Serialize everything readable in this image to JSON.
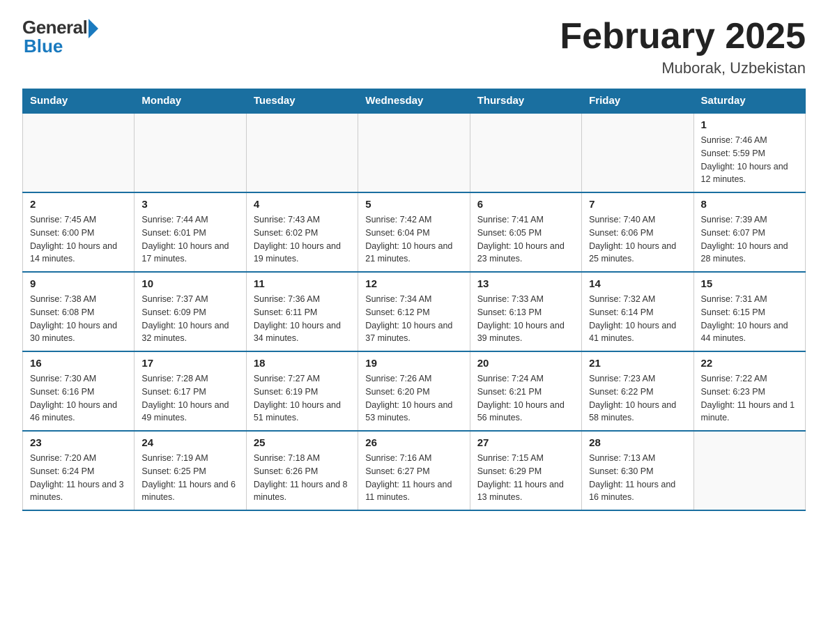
{
  "header": {
    "logo": {
      "general": "General",
      "blue": "Blue"
    },
    "title": "February 2025",
    "location": "Muborak, Uzbekistan"
  },
  "days_of_week": [
    "Sunday",
    "Monday",
    "Tuesday",
    "Wednesday",
    "Thursday",
    "Friday",
    "Saturday"
  ],
  "weeks": [
    [
      {
        "day": "",
        "info": ""
      },
      {
        "day": "",
        "info": ""
      },
      {
        "day": "",
        "info": ""
      },
      {
        "day": "",
        "info": ""
      },
      {
        "day": "",
        "info": ""
      },
      {
        "day": "",
        "info": ""
      },
      {
        "day": "1",
        "info": "Sunrise: 7:46 AM\nSunset: 5:59 PM\nDaylight: 10 hours and 12 minutes."
      }
    ],
    [
      {
        "day": "2",
        "info": "Sunrise: 7:45 AM\nSunset: 6:00 PM\nDaylight: 10 hours and 14 minutes."
      },
      {
        "day": "3",
        "info": "Sunrise: 7:44 AM\nSunset: 6:01 PM\nDaylight: 10 hours and 17 minutes."
      },
      {
        "day": "4",
        "info": "Sunrise: 7:43 AM\nSunset: 6:02 PM\nDaylight: 10 hours and 19 minutes."
      },
      {
        "day": "5",
        "info": "Sunrise: 7:42 AM\nSunset: 6:04 PM\nDaylight: 10 hours and 21 minutes."
      },
      {
        "day": "6",
        "info": "Sunrise: 7:41 AM\nSunset: 6:05 PM\nDaylight: 10 hours and 23 minutes."
      },
      {
        "day": "7",
        "info": "Sunrise: 7:40 AM\nSunset: 6:06 PM\nDaylight: 10 hours and 25 minutes."
      },
      {
        "day": "8",
        "info": "Sunrise: 7:39 AM\nSunset: 6:07 PM\nDaylight: 10 hours and 28 minutes."
      }
    ],
    [
      {
        "day": "9",
        "info": "Sunrise: 7:38 AM\nSunset: 6:08 PM\nDaylight: 10 hours and 30 minutes."
      },
      {
        "day": "10",
        "info": "Sunrise: 7:37 AM\nSunset: 6:09 PM\nDaylight: 10 hours and 32 minutes."
      },
      {
        "day": "11",
        "info": "Sunrise: 7:36 AM\nSunset: 6:11 PM\nDaylight: 10 hours and 34 minutes."
      },
      {
        "day": "12",
        "info": "Sunrise: 7:34 AM\nSunset: 6:12 PM\nDaylight: 10 hours and 37 minutes."
      },
      {
        "day": "13",
        "info": "Sunrise: 7:33 AM\nSunset: 6:13 PM\nDaylight: 10 hours and 39 minutes."
      },
      {
        "day": "14",
        "info": "Sunrise: 7:32 AM\nSunset: 6:14 PM\nDaylight: 10 hours and 41 minutes."
      },
      {
        "day": "15",
        "info": "Sunrise: 7:31 AM\nSunset: 6:15 PM\nDaylight: 10 hours and 44 minutes."
      }
    ],
    [
      {
        "day": "16",
        "info": "Sunrise: 7:30 AM\nSunset: 6:16 PM\nDaylight: 10 hours and 46 minutes."
      },
      {
        "day": "17",
        "info": "Sunrise: 7:28 AM\nSunset: 6:17 PM\nDaylight: 10 hours and 49 minutes."
      },
      {
        "day": "18",
        "info": "Sunrise: 7:27 AM\nSunset: 6:19 PM\nDaylight: 10 hours and 51 minutes."
      },
      {
        "day": "19",
        "info": "Sunrise: 7:26 AM\nSunset: 6:20 PM\nDaylight: 10 hours and 53 minutes."
      },
      {
        "day": "20",
        "info": "Sunrise: 7:24 AM\nSunset: 6:21 PM\nDaylight: 10 hours and 56 minutes."
      },
      {
        "day": "21",
        "info": "Sunrise: 7:23 AM\nSunset: 6:22 PM\nDaylight: 10 hours and 58 minutes."
      },
      {
        "day": "22",
        "info": "Sunrise: 7:22 AM\nSunset: 6:23 PM\nDaylight: 11 hours and 1 minute."
      }
    ],
    [
      {
        "day": "23",
        "info": "Sunrise: 7:20 AM\nSunset: 6:24 PM\nDaylight: 11 hours and 3 minutes."
      },
      {
        "day": "24",
        "info": "Sunrise: 7:19 AM\nSunset: 6:25 PM\nDaylight: 11 hours and 6 minutes."
      },
      {
        "day": "25",
        "info": "Sunrise: 7:18 AM\nSunset: 6:26 PM\nDaylight: 11 hours and 8 minutes."
      },
      {
        "day": "26",
        "info": "Sunrise: 7:16 AM\nSunset: 6:27 PM\nDaylight: 11 hours and 11 minutes."
      },
      {
        "day": "27",
        "info": "Sunrise: 7:15 AM\nSunset: 6:29 PM\nDaylight: 11 hours and 13 minutes."
      },
      {
        "day": "28",
        "info": "Sunrise: 7:13 AM\nSunset: 6:30 PM\nDaylight: 11 hours and 16 minutes."
      },
      {
        "day": "",
        "info": ""
      }
    ]
  ]
}
